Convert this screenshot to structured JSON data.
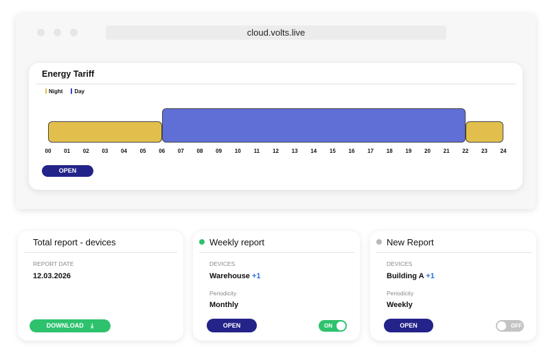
{
  "browser": {
    "url": "cloud.volts.live"
  },
  "tariff": {
    "title": "Energy Tariff",
    "open_label": "OPEN"
  },
  "chart_data": {
    "type": "bar",
    "legend": [
      {
        "name": "Night",
        "color": "#e2bf4c"
      },
      {
        "name": "Day",
        "color": "#5f6fd6"
      }
    ],
    "x_ticks": [
      "00",
      "01",
      "02",
      "03",
      "04",
      "05",
      "06",
      "07",
      "08",
      "09",
      "10",
      "11",
      "12",
      "13",
      "14",
      "15",
      "16",
      "17",
      "18",
      "19",
      "20",
      "21",
      "22",
      "23",
      "24"
    ],
    "xlim": [
      0,
      24
    ],
    "segments": [
      {
        "series": "Night",
        "start": 0,
        "end": 6,
        "level": 1
      },
      {
        "series": "Day",
        "start": 6,
        "end": 22,
        "level": 1.6
      },
      {
        "series": "Night",
        "start": 22,
        "end": 24,
        "level": 1
      }
    ]
  },
  "reports": [
    {
      "title": "Total report - devices",
      "label1": "REPORT DATE",
      "value1": "12.03.2026",
      "button": "DOWNLOAD",
      "icon": "download-icon"
    },
    {
      "title": "Weekly report",
      "status_color": "#2ec26e",
      "label1": "DEVICES",
      "value1": "Warehouse",
      "extra1": "+1",
      "label2": "Periodicity",
      "value2": "Monthly",
      "button": "OPEN",
      "toggle": "ON",
      "toggle_on": true
    },
    {
      "title": "New Report",
      "status_color": "#b8b8b8",
      "label1": "DEVICES",
      "value1": "Building A",
      "extra1": "+1",
      "label2": "Periodicity",
      "value2": "Weekly",
      "button": "OPEN",
      "toggle": "OFF",
      "toggle_on": false
    }
  ]
}
